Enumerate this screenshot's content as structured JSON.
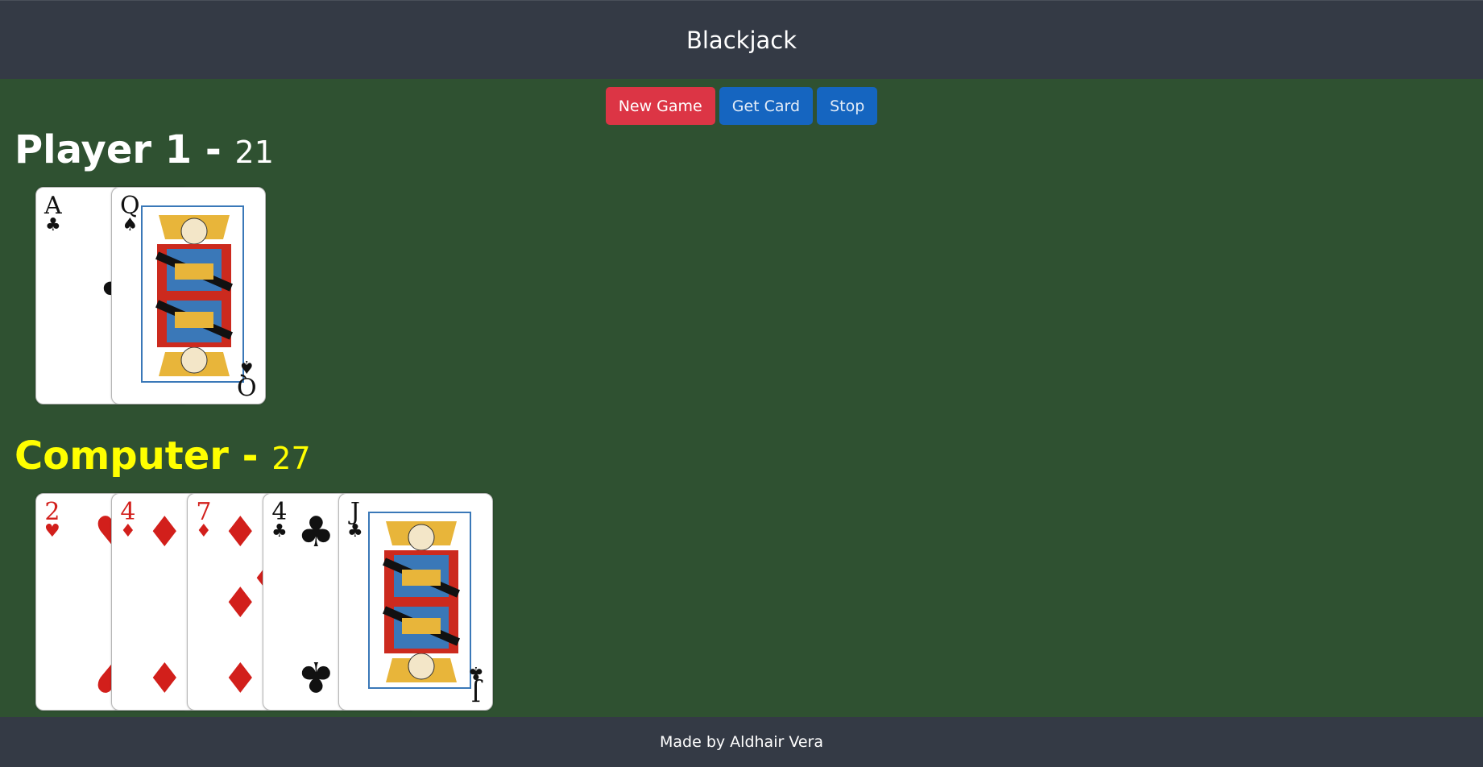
{
  "header": {
    "title": "Blackjack"
  },
  "controls": {
    "new_game": "New Game",
    "get_card": "Get Card",
    "stop": "Stop"
  },
  "player": {
    "name": "Player 1",
    "separator": " - ",
    "score": "21",
    "cards": [
      {
        "rank": "A",
        "suit": "♣",
        "color": "black"
      },
      {
        "rank": "Q",
        "suit": "♠",
        "color": "black",
        "face": true
      }
    ]
  },
  "computer": {
    "name": "Computer",
    "separator": " - ",
    "score": "27",
    "cards": [
      {
        "rank": "2",
        "suit": "♥",
        "color": "red"
      },
      {
        "rank": "4",
        "suit": "♦",
        "color": "red"
      },
      {
        "rank": "7",
        "suit": "♦",
        "color": "red"
      },
      {
        "rank": "4",
        "suit": "♣",
        "color": "black"
      },
      {
        "rank": "J",
        "suit": "♣",
        "color": "black",
        "face": true
      }
    ]
  },
  "footer": {
    "text": "Made by Aldhair Vera"
  },
  "colors": {
    "table": "#2f5131",
    "bar": "#343a45",
    "danger": "#dc3545",
    "primary": "#1565c0",
    "computer_title": "#ffff00",
    "red_suit": "#d21f1b"
  }
}
